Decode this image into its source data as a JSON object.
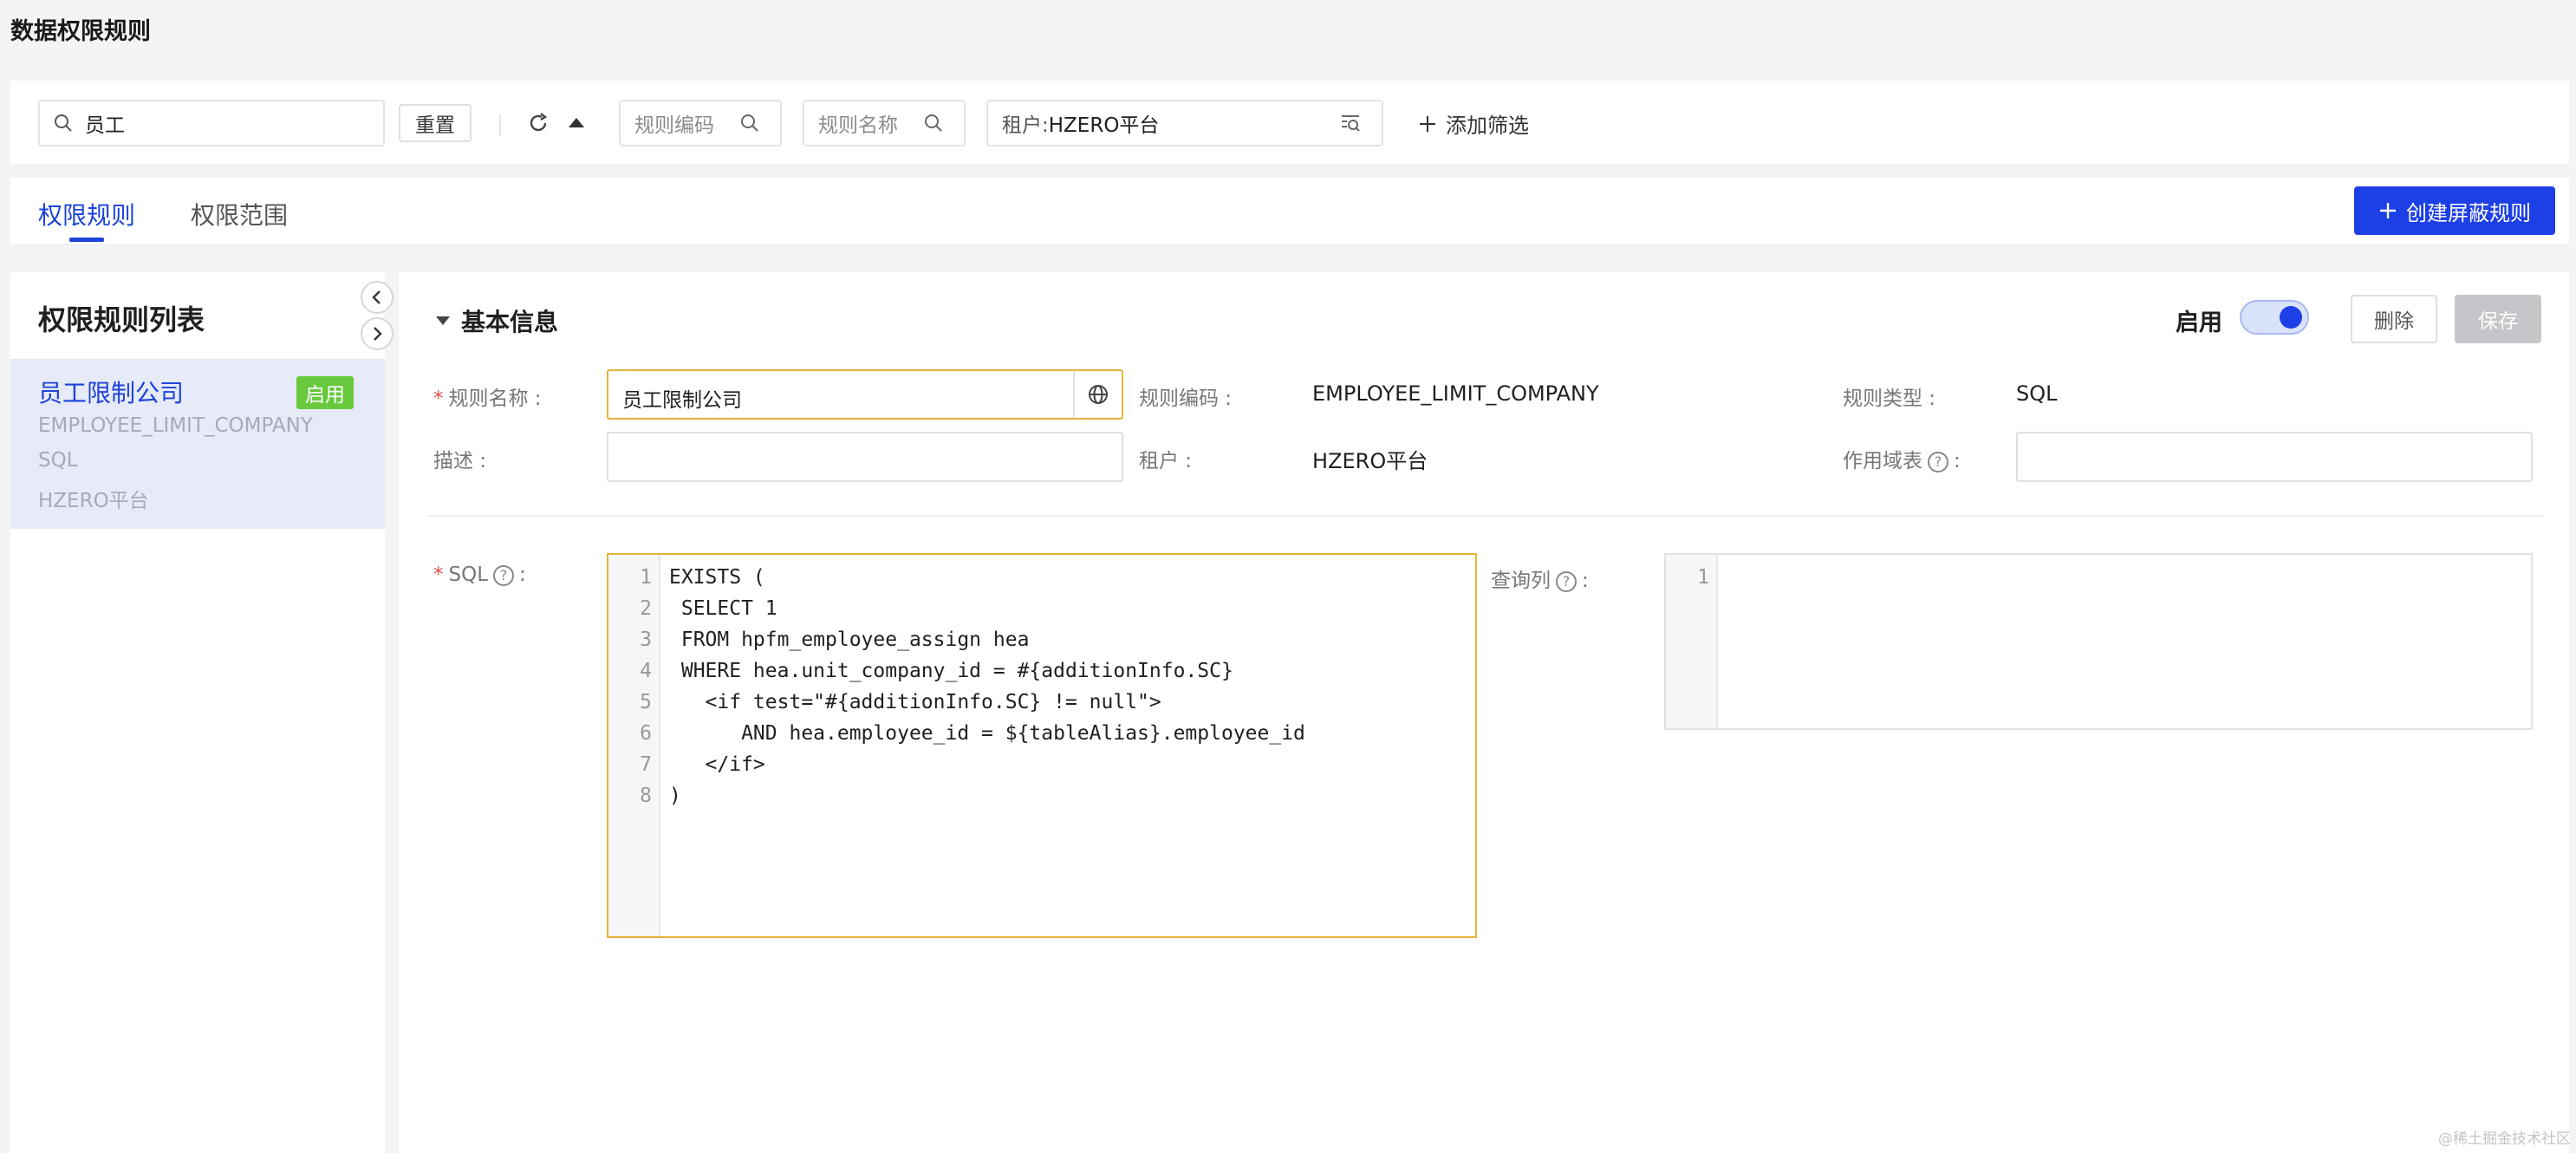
{
  "page": {
    "title": "数据权限规则"
  },
  "filter": {
    "search_value": "员工",
    "reset_label": "重置",
    "rule_code_placeholder": "规则编码",
    "rule_name_placeholder": "规则名称",
    "tenant_label": "租户:",
    "tenant_value": "HZERO平台",
    "add_filter_label": "添加筛选"
  },
  "tabs": [
    {
      "label": "权限规则",
      "active": true
    },
    {
      "label": "权限范围",
      "active": false
    }
  ],
  "create_button_label": "创建屏蔽规则",
  "left_panel": {
    "title": "权限规则列表",
    "items": [
      {
        "name": "员工限制公司",
        "status": "启用",
        "code": "EMPLOYEE_LIMIT_COMPANY",
        "type": "SQL",
        "tenant": "HZERO平台"
      }
    ]
  },
  "detail": {
    "section_title": "基本信息",
    "enable_label": "启用",
    "enabled": true,
    "delete_label": "删除",
    "save_label": "保存",
    "fields": {
      "rule_name_label": "规则名称 :",
      "rule_name_value": "员工限制公司",
      "rule_code_label": "规则编码 :",
      "rule_code_value": "EMPLOYEE_LIMIT_COMPANY",
      "rule_type_label": "规则类型 :",
      "rule_type_value": "SQL",
      "description_label": "描述 :",
      "description_value": "",
      "tenant_label": "租户 :",
      "tenant_value": "HZERO平台",
      "scope_table_label": "作用域表",
      "scope_table_value": "",
      "sql_label": "SQL",
      "query_column_label": "查询列"
    },
    "sql_lines": [
      "EXISTS (",
      " SELECT 1",
      " FROM hpfm_employee_assign hea",
      " WHERE hea.unit_company_id = #{additionInfo.SC}",
      "   <if test=\"#{additionInfo.SC} != null\">",
      "      AND hea.employee_id = ${tableAlias}.employee_id",
      "   </if>",
      ")"
    ],
    "query_lines": [
      ""
    ]
  },
  "watermark": "@稀土掘金技术社区",
  "colors": {
    "primary": "#1d3fe6",
    "success": "#52c41a",
    "editor_border": "#e3b43a"
  }
}
